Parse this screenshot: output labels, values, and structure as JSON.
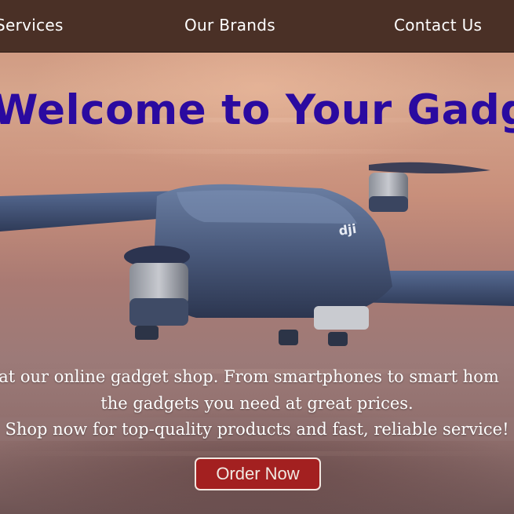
{
  "nav": {
    "services": "Services",
    "brands": "Our Brands",
    "contact": "Contact Us"
  },
  "hero": {
    "title": "Welcome to Your Gadget",
    "line1": "h at our online gadget shop. From smartphones to smart hom",
    "line2": "the gadgets you need at great prices.",
    "line3": "Shop now for top-quality products and fast, reliable service!",
    "button": "Order Now",
    "drone_brand": "dji"
  },
  "colors": {
    "navbar": "#4a3026",
    "title": "#2a0aa0",
    "button": "#a32020"
  }
}
